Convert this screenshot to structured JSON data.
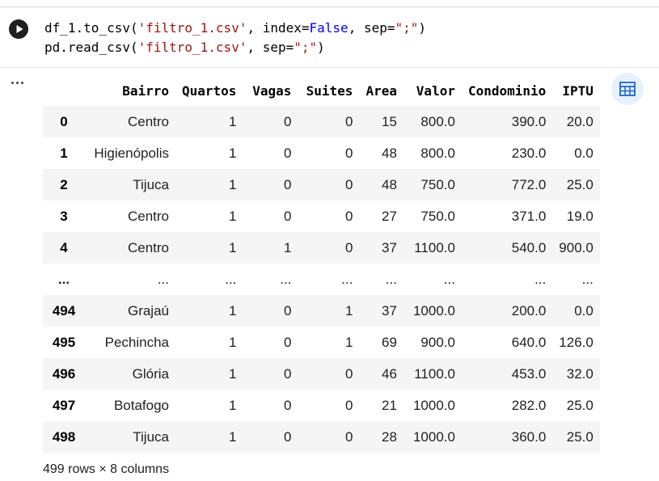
{
  "code": {
    "line1": {
      "p1": "df_1.to_csv(",
      "s1": "'filtro_1.csv'",
      "p2": ", index=",
      "kw": "False",
      "p3": ", sep=",
      "s2": "\";\"",
      "p4": ")"
    },
    "line2": {
      "p1": "pd.read_csv(",
      "s1": "'filtro_1.csv'",
      "p2": ", sep=",
      "s2": "\";\"",
      "p3": ")"
    }
  },
  "icons": {
    "run": "play-icon",
    "menu": "more-horizontal-icon",
    "table_view": "table-grid-icon"
  },
  "colors": {
    "accent": "#1a73e8",
    "row_stripe": "#f5f5f5",
    "run_button": "#1f1f1f"
  },
  "table": {
    "columns": [
      "Bairro",
      "Quartos",
      "Vagas",
      "Suites",
      "Area",
      "Valor",
      "Condominio",
      "IPTU"
    ],
    "rows": [
      {
        "idx": "0",
        "cells": [
          "Centro",
          "1",
          "0",
          "0",
          "15",
          "800.0",
          "390.0",
          "20.0"
        ]
      },
      {
        "idx": "1",
        "cells": [
          "Higienópolis",
          "1",
          "0",
          "0",
          "48",
          "800.0",
          "230.0",
          "0.0"
        ]
      },
      {
        "idx": "2",
        "cells": [
          "Tijuca",
          "1",
          "0",
          "0",
          "48",
          "750.0",
          "772.0",
          "25.0"
        ]
      },
      {
        "idx": "3",
        "cells": [
          "Centro",
          "1",
          "0",
          "0",
          "27",
          "750.0",
          "371.0",
          "19.0"
        ]
      },
      {
        "idx": "4",
        "cells": [
          "Centro",
          "1",
          "1",
          "0",
          "37",
          "1100.0",
          "540.0",
          "900.0"
        ]
      },
      {
        "idx": "...",
        "cells": [
          "...",
          "...",
          "...",
          "...",
          "...",
          "...",
          "...",
          "..."
        ]
      },
      {
        "idx": "494",
        "cells": [
          "Grajaú",
          "1",
          "0",
          "1",
          "37",
          "1000.0",
          "200.0",
          "0.0"
        ]
      },
      {
        "idx": "495",
        "cells": [
          "Pechincha",
          "1",
          "0",
          "1",
          "69",
          "900.0",
          "640.0",
          "126.0"
        ]
      },
      {
        "idx": "496",
        "cells": [
          "Glória",
          "1",
          "0",
          "0",
          "46",
          "1100.0",
          "453.0",
          "32.0"
        ]
      },
      {
        "idx": "497",
        "cells": [
          "Botafogo",
          "1",
          "0",
          "0",
          "21",
          "1000.0",
          "282.0",
          "25.0"
        ]
      },
      {
        "idx": "498",
        "cells": [
          "Tijuca",
          "1",
          "0",
          "0",
          "28",
          "1000.0",
          "360.0",
          "25.0"
        ]
      }
    ],
    "shape": "499 rows × 8 columns"
  }
}
